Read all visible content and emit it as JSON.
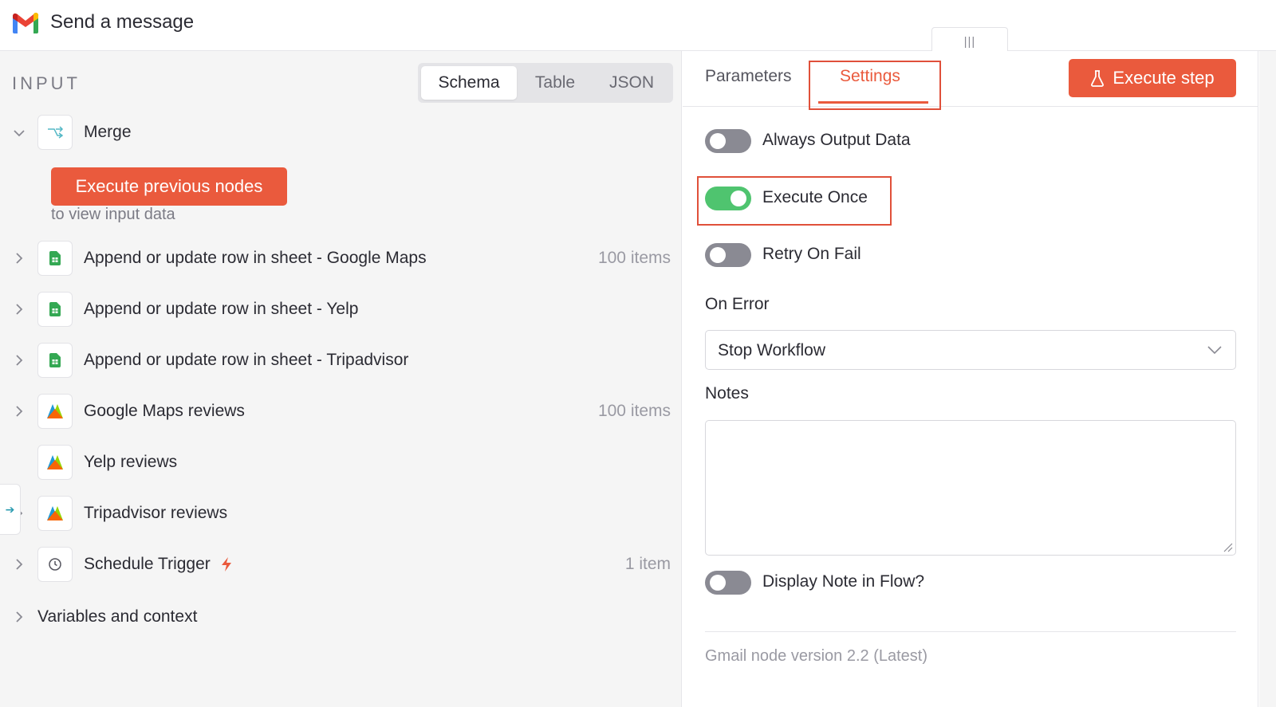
{
  "header": {
    "title": "Send a message",
    "handle": "|||"
  },
  "input_panel": {
    "label": "INPUT",
    "view_options": [
      "Schema",
      "Table",
      "JSON"
    ],
    "selected_view": "Schema",
    "merge_node": {
      "label": "Merge",
      "icon": "merge-icon"
    },
    "execute_previous_label": "Execute previous nodes",
    "execute_hint": "to view input data",
    "nodes": [
      {
        "label": "Append or update row in sheet - Google Maps",
        "count": "100 items",
        "icon": "sheets-icon"
      },
      {
        "label": "Append or update row in sheet - Yelp",
        "count": "",
        "icon": "sheets-icon"
      },
      {
        "label": "Append or update row in sheet - Tripadvisor",
        "count": "",
        "icon": "sheets-icon"
      },
      {
        "label": "Google Maps reviews",
        "count": "100 items",
        "icon": "apify-icon"
      },
      {
        "label": "Yelp reviews",
        "count": "",
        "icon": "apify-icon"
      },
      {
        "label": "Tripadvisor reviews",
        "count": "",
        "icon": "apify-icon"
      },
      {
        "label": "Schedule Trigger",
        "count": "1 item",
        "icon": "clock-icon"
      }
    ],
    "variables_label": "Variables and context"
  },
  "settings_panel": {
    "tabs": [
      "Parameters",
      "Settings"
    ],
    "active_tab": "Settings",
    "execute_step_label": "Execute step",
    "toggles": {
      "always_output": {
        "label": "Always Output Data",
        "on": false
      },
      "execute_once": {
        "label": "Execute Once",
        "on": true
      },
      "retry_on_fail": {
        "label": "Retry On Fail",
        "on": false
      },
      "display_note": {
        "label": "Display Note in Flow?",
        "on": false
      }
    },
    "on_error": {
      "label": "On Error",
      "value": "Stop Workflow"
    },
    "notes": {
      "label": "Notes",
      "value": ""
    },
    "version_text": "Gmail node version 2.2 (Latest)"
  },
  "colors": {
    "accent": "#ea5a3d",
    "toggle_on": "#4fc46f",
    "toggle_off": "#8a8a93",
    "highlight": "#e0503a"
  }
}
